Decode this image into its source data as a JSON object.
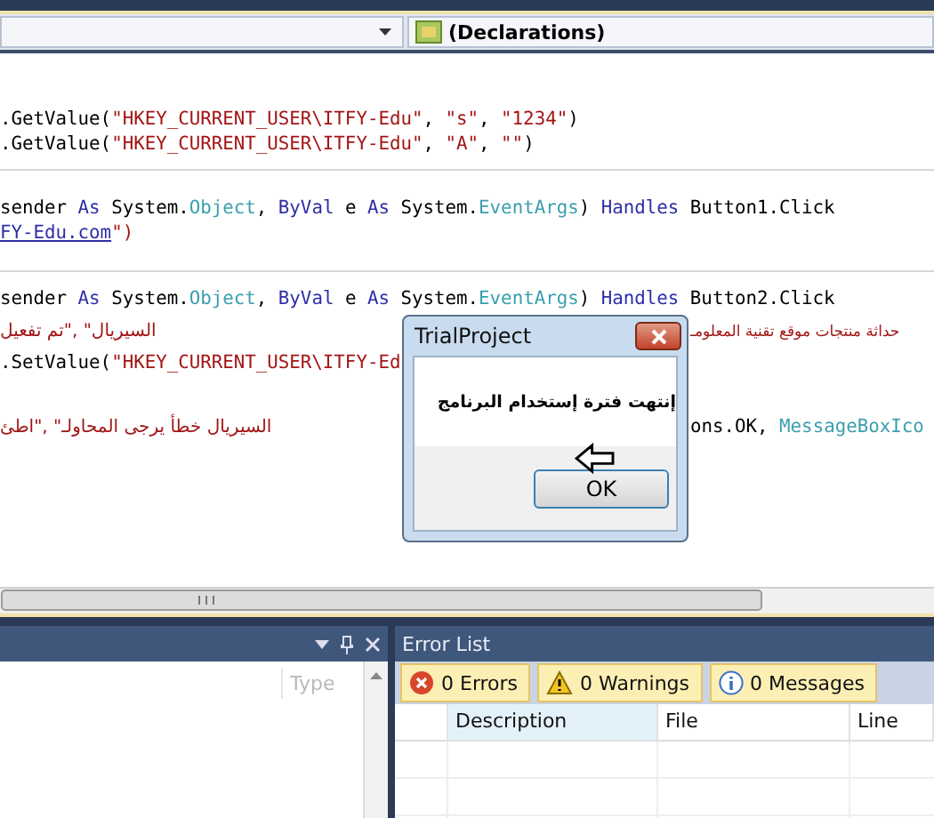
{
  "navigation_bar": {
    "member_dropdown": "(Declarations)"
  },
  "code_blocks": [
    {
      "lines": [
        {
          "left": [
            {
              "text": ".GetValue(",
              "kind": "plain"
            },
            {
              "text": "\"HKEY_CURRENT_USER\\ITFY-Edu\"",
              "kind": "string"
            },
            {
              "text": ", ",
              "kind": "plain"
            },
            {
              "text": "\"s\"",
              "kind": "string"
            },
            {
              "text": ", ",
              "kind": "plain"
            },
            {
              "text": "\"1234\"",
              "kind": "string"
            },
            {
              "text": ")",
              "kind": "plain"
            }
          ]
        },
        {
          "left": [
            {
              "text": ".GetValue(",
              "kind": "plain"
            },
            {
              "text": "\"HKEY_CURRENT_USER\\ITFY-Edu\"",
              "kind": "string"
            },
            {
              "text": ", ",
              "kind": "plain"
            },
            {
              "text": "\"A\"",
              "kind": "string"
            },
            {
              "text": ", ",
              "kind": "plain"
            },
            {
              "text": "\"\"",
              "kind": "string"
            },
            {
              "text": ")",
              "kind": "plain"
            }
          ]
        }
      ]
    },
    {
      "lines": [
        {
          "left": [
            {
              "text": "sender ",
              "kind": "plain"
            },
            {
              "text": "As",
              "kind": "keyword"
            },
            {
              "text": " System.",
              "kind": "plain"
            },
            {
              "text": "Object",
              "kind": "type"
            },
            {
              "text": ", ",
              "kind": "plain"
            },
            {
              "text": "ByVal",
              "kind": "keyword"
            },
            {
              "text": " e ",
              "kind": "plain"
            },
            {
              "text": "As",
              "kind": "keyword"
            },
            {
              "text": " System.",
              "kind": "plain"
            },
            {
              "text": "EventArgs",
              "kind": "type"
            },
            {
              "text": ") ",
              "kind": "plain"
            },
            {
              "text": "Handles",
              "kind": "keyword"
            },
            {
              "text": " Button1.Click",
              "kind": "plain"
            }
          ]
        },
        {
          "left": [
            {
              "text": "FY-Edu.com",
              "kind": "link"
            },
            {
              "text": "\")",
              "kind": "string"
            }
          ]
        }
      ]
    },
    {
      "lines": [
        {
          "left": [
            {
              "text": "sender ",
              "kind": "plain"
            },
            {
              "text": "As",
              "kind": "keyword"
            },
            {
              "text": " System.",
              "kind": "plain"
            },
            {
              "text": "Object",
              "kind": "type"
            },
            {
              "text": ", ",
              "kind": "plain"
            },
            {
              "text": "ByVal",
              "kind": "keyword"
            },
            {
              "text": " e ",
              "kind": "plain"
            },
            {
              "text": "As",
              "kind": "keyword"
            },
            {
              "text": " System.",
              "kind": "plain"
            },
            {
              "text": "EventArgs",
              "kind": "type"
            },
            {
              "text": ") ",
              "kind": "plain"
            },
            {
              "text": "Handles",
              "kind": "keyword"
            },
            {
              "text": " Button2.Click",
              "kind": "plain"
            }
          ]
        },
        {
          "left": [
            {
              "text": "السيريال\" ,\"تم تفعيل",
              "kind": "arabic"
            }
          ],
          "right": [
            {
              "text": "حداثة منتجات موقع تقنية المعلومـ",
              "kind": "arabic"
            }
          ]
        },
        {
          "left": [
            {
              "text": ".SetValue(",
              "kind": "plain"
            },
            {
              "text": "\"HKEY_CURRENT_USER\\ITFY-Ed",
              "kind": "string"
            }
          ]
        },
        {
          "left": [
            {
              "text": "السيريال خطأ يرجى المحاولـ\" ,\"اطئ",
              "kind": "arabic"
            }
          ],
          "right": [
            {
              "text": "ons.OK, ",
              "kind": "plain"
            },
            {
              "text": "MessageBoxIco",
              "kind": "type"
            }
          ]
        }
      ]
    }
  ],
  "dialog": {
    "title": "TrialProject",
    "message": "إنتهت فترة إستخدام البرنامج",
    "button": "OK"
  },
  "left_panel": {
    "column": "Type"
  },
  "error_list": {
    "title": "Error List",
    "filters": [
      {
        "kind": "error",
        "label": "0 Errors",
        "selected": true
      },
      {
        "kind": "warning",
        "label": "0 Warnings",
        "selected": true
      },
      {
        "kind": "message",
        "label": "0 Messages",
        "selected": true
      }
    ],
    "columns": [
      "Description",
      "File",
      "Line"
    ]
  }
}
